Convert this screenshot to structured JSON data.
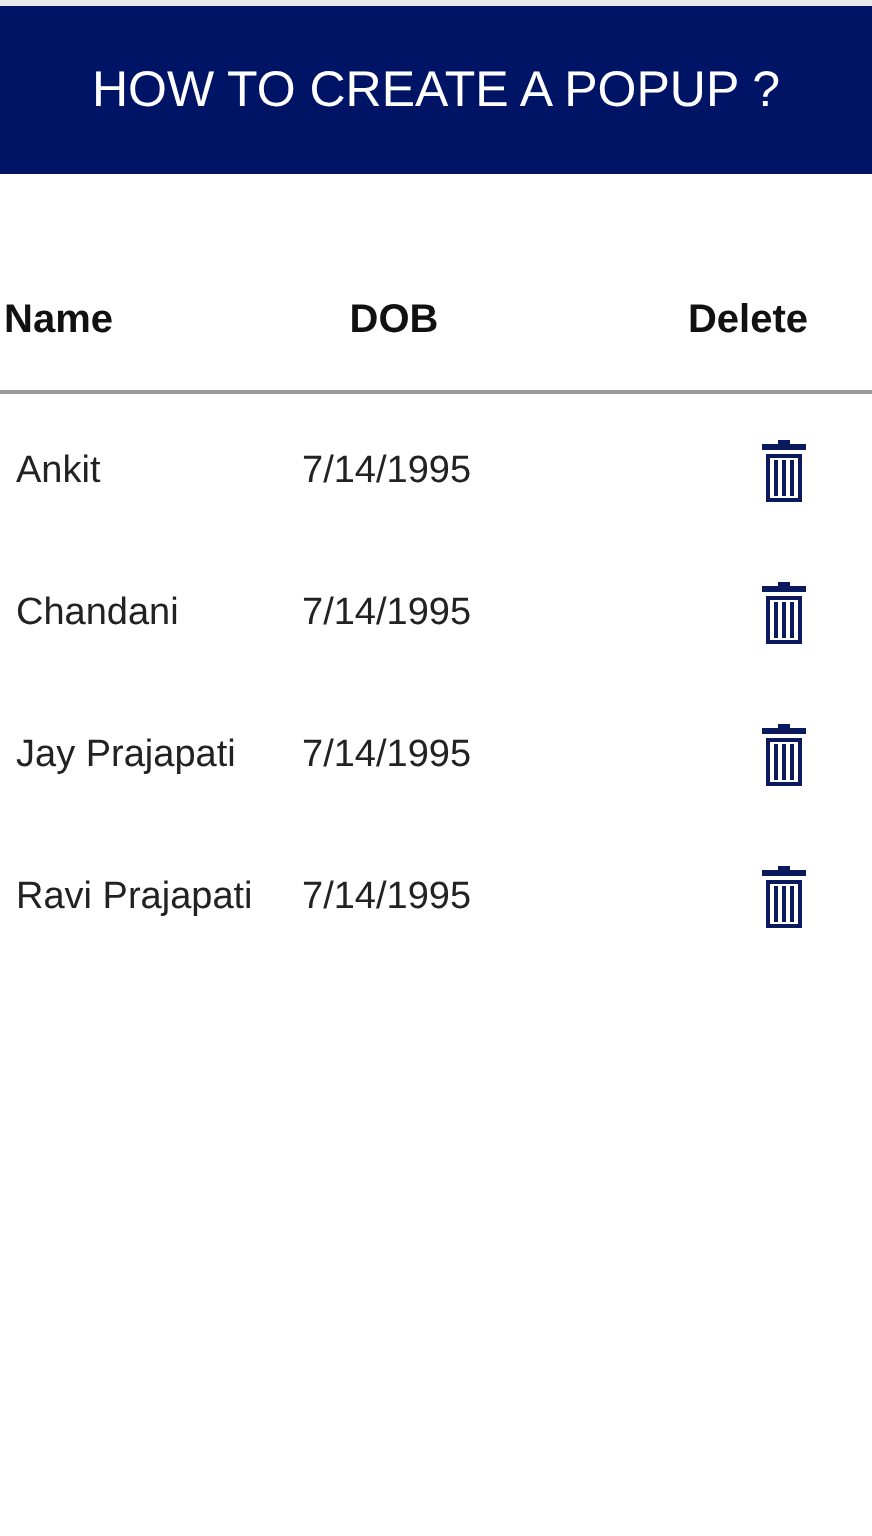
{
  "header": {
    "title": "HOW TO CREATE A POPUP ?"
  },
  "table": {
    "columns": [
      "Name",
      "DOB",
      "Delete"
    ],
    "rows": [
      {
        "name": "Ankit",
        "dob": "7/14/1995"
      },
      {
        "name": "Chandani",
        "dob": "7/14/1995"
      },
      {
        "name": "Jay Prajapati",
        "dob": "7/14/1995"
      },
      {
        "name": "Ravi Prajapati",
        "dob": "7/14/1995"
      }
    ]
  }
}
